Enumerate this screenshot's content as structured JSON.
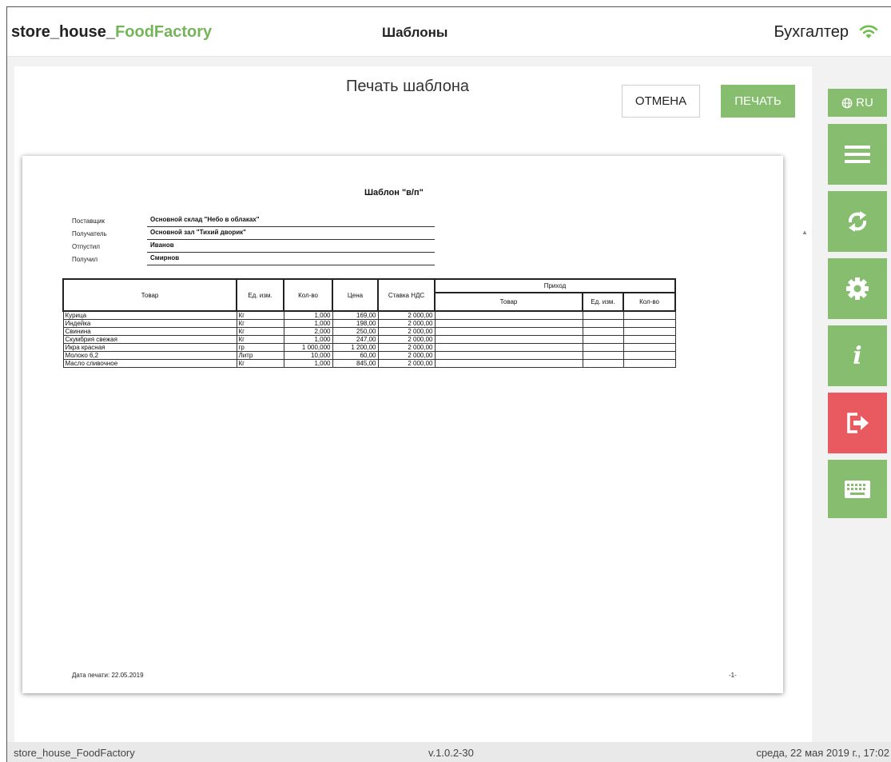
{
  "app": {
    "brand_prefix": "store_house_",
    "brand_accent": "FoodFactory",
    "page_title": "Шаблоны",
    "user_role": "Бухгалтер",
    "accent_color": "#86bd6e",
    "danger_color": "#e85a5f"
  },
  "dialog": {
    "title": "Печать шаблона",
    "cancel_label": "ОТМЕНА",
    "print_label": "ПЕЧАТЬ"
  },
  "document": {
    "title": "Шаблон \"в/п\"",
    "header_fields": [
      {
        "label": "Поставщик",
        "value": "Основной склад \"Небо в облаках\""
      },
      {
        "label": "Получатель",
        "value": "Основной зал \"Тихий дворик\""
      },
      {
        "label": "Отпустил",
        "value": "Иванов"
      },
      {
        "label": "Получил",
        "value": "Смирнов"
      }
    ],
    "columns": {
      "item": "Товар",
      "unit": "Ед. изм.",
      "qty": "Кол-во",
      "price": "Цена",
      "vat": "Ставка НДС",
      "receipt_group": "Приход",
      "receipt_item": "Товар",
      "receipt_unit": "Ед. изм.",
      "receipt_qty": "Кол-во"
    },
    "rows": [
      {
        "item": "Курица",
        "unit": "Кг",
        "qty": "1,000",
        "price": "169,00",
        "vat": "2 000,00"
      },
      {
        "item": "Индейка",
        "unit": "Кг",
        "qty": "1,000",
        "price": "198,00",
        "vat": "2 000,00"
      },
      {
        "item": "Свинина",
        "unit": "Кг",
        "qty": "2,000",
        "price": "250,00",
        "vat": "2 000,00"
      },
      {
        "item": "Скумбрия свежая",
        "unit": "Кг",
        "qty": "1,000",
        "price": "247,00",
        "vat": "2 000,00"
      },
      {
        "item": "Икра красная",
        "unit": "гр",
        "qty": "1 000,000",
        "price": "1 200,00",
        "vat": "2 000,00"
      },
      {
        "item": "Молоко 6,2",
        "unit": "Литр",
        "qty": "10,000",
        "price": "60,00",
        "vat": "2 000,00"
      },
      {
        "item": "Масло сливочное",
        "unit": "Кг",
        "qty": "1,000",
        "price": "845,00",
        "vat": "2 000,00"
      }
    ],
    "print_date": "Дата печати: 22.05.2019",
    "page_number": "-1-"
  },
  "sidebar": {
    "language_label": "RU",
    "buttons": [
      {
        "name": "menu",
        "icon": "menu-icon"
      },
      {
        "name": "sync",
        "icon": "sync-icon"
      },
      {
        "name": "settings",
        "icon": "gear-icon"
      },
      {
        "name": "info",
        "icon": "info-icon"
      },
      {
        "name": "logout",
        "icon": "logout-icon"
      },
      {
        "name": "keyboard",
        "icon": "keyboard-icon"
      }
    ]
  },
  "status": {
    "app_name": "store_house_FoodFactory",
    "version": "v.1.0.2-30",
    "datetime": "среда, 22 мая 2019 г., 17:02"
  }
}
